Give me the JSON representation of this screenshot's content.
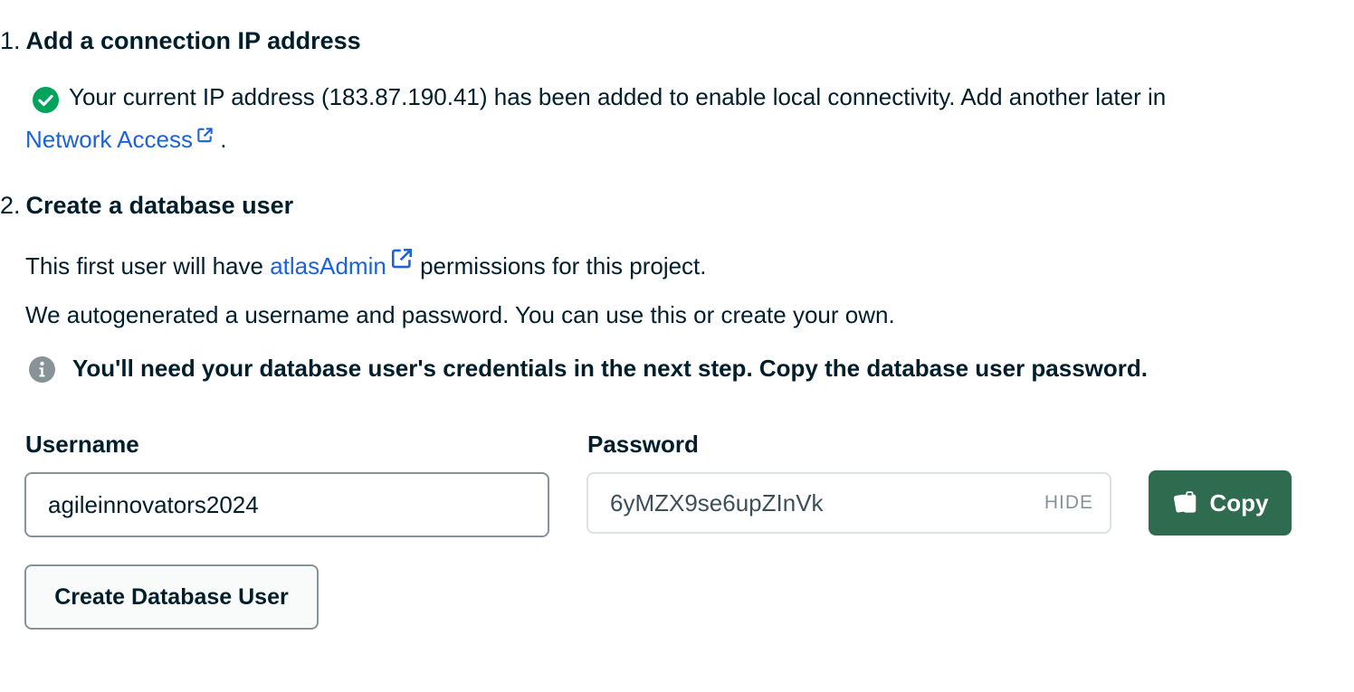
{
  "step1": {
    "number": "1.",
    "title": "Add a connection IP address",
    "message": "Your current IP address (183.87.190.41) has been added to enable local connectivity. Add another later in",
    "link_label": "Network Access",
    "trailing": "."
  },
  "step2": {
    "number": "2.",
    "title": "Create a database user",
    "permissions_prefix": "This first user will have",
    "permissions_link": "atlasAdmin",
    "permissions_suffix": "permissions for this project.",
    "autogen_note": "We autogenerated a username and password. You can use this or create your own.",
    "callout": "You'll need your database user's credentials in the next step. Copy the database user password."
  },
  "form": {
    "username_label": "Username",
    "username_value": "agileinnovators2024",
    "password_label": "Password",
    "password_value": "6yMZX9se6upZInVk",
    "hide_label": "HIDE",
    "copy_label": "Copy",
    "create_button": "Create Database User"
  },
  "colors": {
    "link": "#1a63d8",
    "success": "#00a35c",
    "copy_button": "#2e6b4f",
    "info_icon": "#889397"
  },
  "icons": {
    "success": "check-circle-icon",
    "info": "info-circle-icon",
    "external": "external-link-icon",
    "copy": "copy-icon"
  }
}
